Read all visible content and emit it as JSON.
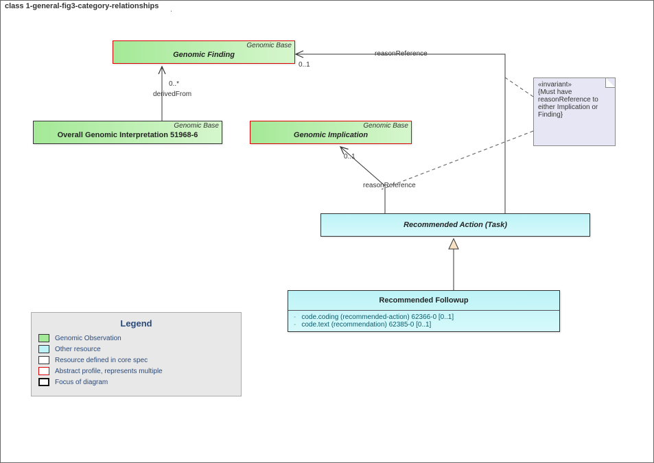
{
  "frame": {
    "title": "class 1-general-fig3-category-relationships"
  },
  "nodes": {
    "genomicFinding": {
      "stereotype": "Genomic Base",
      "title": "Genomic Finding"
    },
    "overallInterp": {
      "stereotype": "Genomic Base",
      "title": "Overall Genomic Interpretation 51968-6"
    },
    "genomicImpl": {
      "stereotype": "Genomic Base",
      "title": "Genomic Implication"
    },
    "recAction": {
      "title": "Recommended Action (Task)"
    },
    "recFollowup": {
      "title": "Recommended Followup",
      "attrs": [
        "code.coding (recommended-action) 62366-0 [0..1]",
        "code.text (recommendation) 62385-0 [0..1]"
      ]
    }
  },
  "note": {
    "stereotype": "«invariant»",
    "text": "{Must have reasonReference to either Implication or Finding}"
  },
  "edges": {
    "derivedFrom": {
      "label": "derivedFrom",
      "mult": "0..*"
    },
    "reasonRef1": {
      "label": "reasonReference",
      "mult": "0..1"
    },
    "reasonRef2": {
      "label": "reasonReference",
      "mult": "0..1"
    }
  },
  "legend": {
    "title": "Legend",
    "items": {
      "genObs": "Genomic Observation",
      "other": "Other resource",
      "core": "Resource defined in core spec",
      "abstract": "Abstract profile, represents multiple",
      "focus": "Focus of diagram"
    }
  }
}
